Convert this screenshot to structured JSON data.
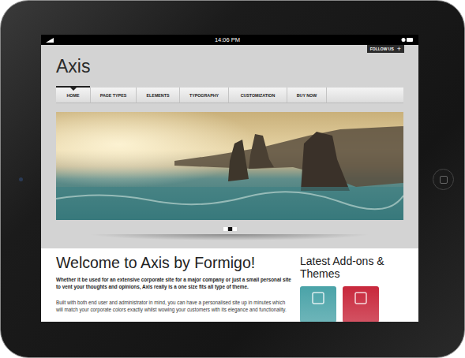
{
  "status_bar": {
    "time": "14:06 PM"
  },
  "follow": {
    "label": "FOLLOW US",
    "icon": "+"
  },
  "logo": "Axis",
  "nav": [
    {
      "label": "HOME",
      "selected": true
    },
    {
      "label": "PAGE TYPES",
      "selected": false
    },
    {
      "label": "ELEMENTS",
      "selected": false
    },
    {
      "label": "TYPOGRAPHY",
      "selected": false
    },
    {
      "label": "CUSTOMIZATION",
      "selected": false
    },
    {
      "label": "BUY NOW",
      "selected": false
    }
  ],
  "slider_dots": [
    {
      "selected": false
    },
    {
      "selected": true
    },
    {
      "selected": false
    }
  ],
  "content": {
    "heading": "Welcome to Axis by Formigo!",
    "intro": "Whether it be used for an extensive corporate site for a major company or just a small personal site to vent your thoughts and opinions, Axis really is a one size fits all type of theme.",
    "body": "Built with both end user and administrator in mind, you can have a personalised site up in minutes which will match your corporate colors exactly whilst wowing your customers with its elegance and functionality."
  },
  "sidebar": {
    "title": "Latest Add-ons & Themes",
    "addons": [
      {
        "color": "#4aa3a8"
      },
      {
        "color": "#c8283c"
      }
    ]
  }
}
